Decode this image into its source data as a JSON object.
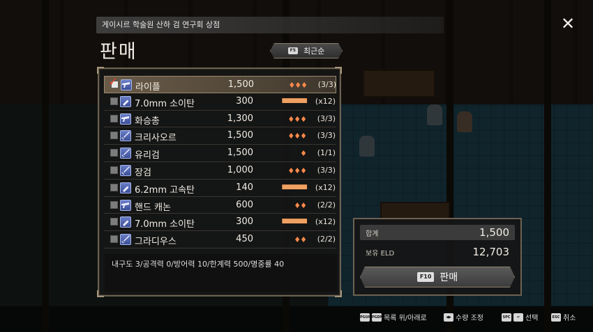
{
  "shop_name": "게이시르 학술원 산하 검 연구회 상점",
  "title": "판매",
  "sort": {
    "key": "F5",
    "label": "최근순"
  },
  "close_icon": "✕",
  "items": [
    {
      "name": "라이플",
      "price": "1,500",
      "qty_icon": "♦♦♦",
      "stock": "(3/3)",
      "checked": true,
      "icon": "gun-icon"
    },
    {
      "name": "7.0mm 소이탄",
      "price": "300",
      "qty_icon": "▮▮▮▮▮▮▮▮▮▮▮▮",
      "stock": "(x12)",
      "checked": false,
      "icon": "ammo-icon"
    },
    {
      "name": "화승총",
      "price": "1,300",
      "qty_icon": "♦♦♦",
      "stock": "(3/3)",
      "checked": false,
      "icon": "gun-icon"
    },
    {
      "name": "크리사오르",
      "price": "1,500",
      "qty_icon": "♦♦♦",
      "stock": "(3/3)",
      "checked": false,
      "icon": "sword-icon"
    },
    {
      "name": "유리검",
      "price": "1,500",
      "qty_icon": "♦",
      "stock": "(1/1)",
      "checked": false,
      "icon": "sword-icon"
    },
    {
      "name": "장검",
      "price": "1,000",
      "qty_icon": "♦♦♦",
      "stock": "(3/3)",
      "checked": false,
      "icon": "sword-icon"
    },
    {
      "name": "6.2mm 고속탄",
      "price": "140",
      "qty_icon": "▮▮▮▮▮▮▮▮▮▮▮▮",
      "stock": "(x12)",
      "checked": false,
      "icon": "ammo-icon"
    },
    {
      "name": "핸드 캐논",
      "price": "600",
      "qty_icon": "♦♦",
      "stock": "(2/2)",
      "checked": false,
      "icon": "gun-icon"
    },
    {
      "name": "7.0mm 소이탄",
      "price": "300",
      "qty_icon": "▮▮▮▮▮▮▮▮▮▮▮▮",
      "stock": "(x12)",
      "checked": false,
      "icon": "ammo-icon"
    },
    {
      "name": "그라디우스",
      "price": "450",
      "qty_icon": "♦♦",
      "stock": "(2/2)",
      "checked": false,
      "icon": "sword-icon"
    }
  ],
  "description": "내구도 3/공격력 0/방어력 10/한계력 500/명중률 40",
  "total": {
    "label": "합계",
    "value": "1,500"
  },
  "owned": {
    "label": "보유 ELD",
    "value": "12,703"
  },
  "sell_button": {
    "key": "F10",
    "label": "판매"
  },
  "hints": [
    {
      "keys": [
        "PGUP",
        "PGDN"
      ],
      "label": "목록 위/아래로"
    },
    {
      "keys": [
        "◀▶"
      ],
      "label": "수량 조정"
    },
    {
      "keys": [
        "SPC",
        "↵"
      ],
      "label": "선택"
    },
    {
      "keys": [
        "ESC"
      ],
      "label": "취소"
    }
  ]
}
